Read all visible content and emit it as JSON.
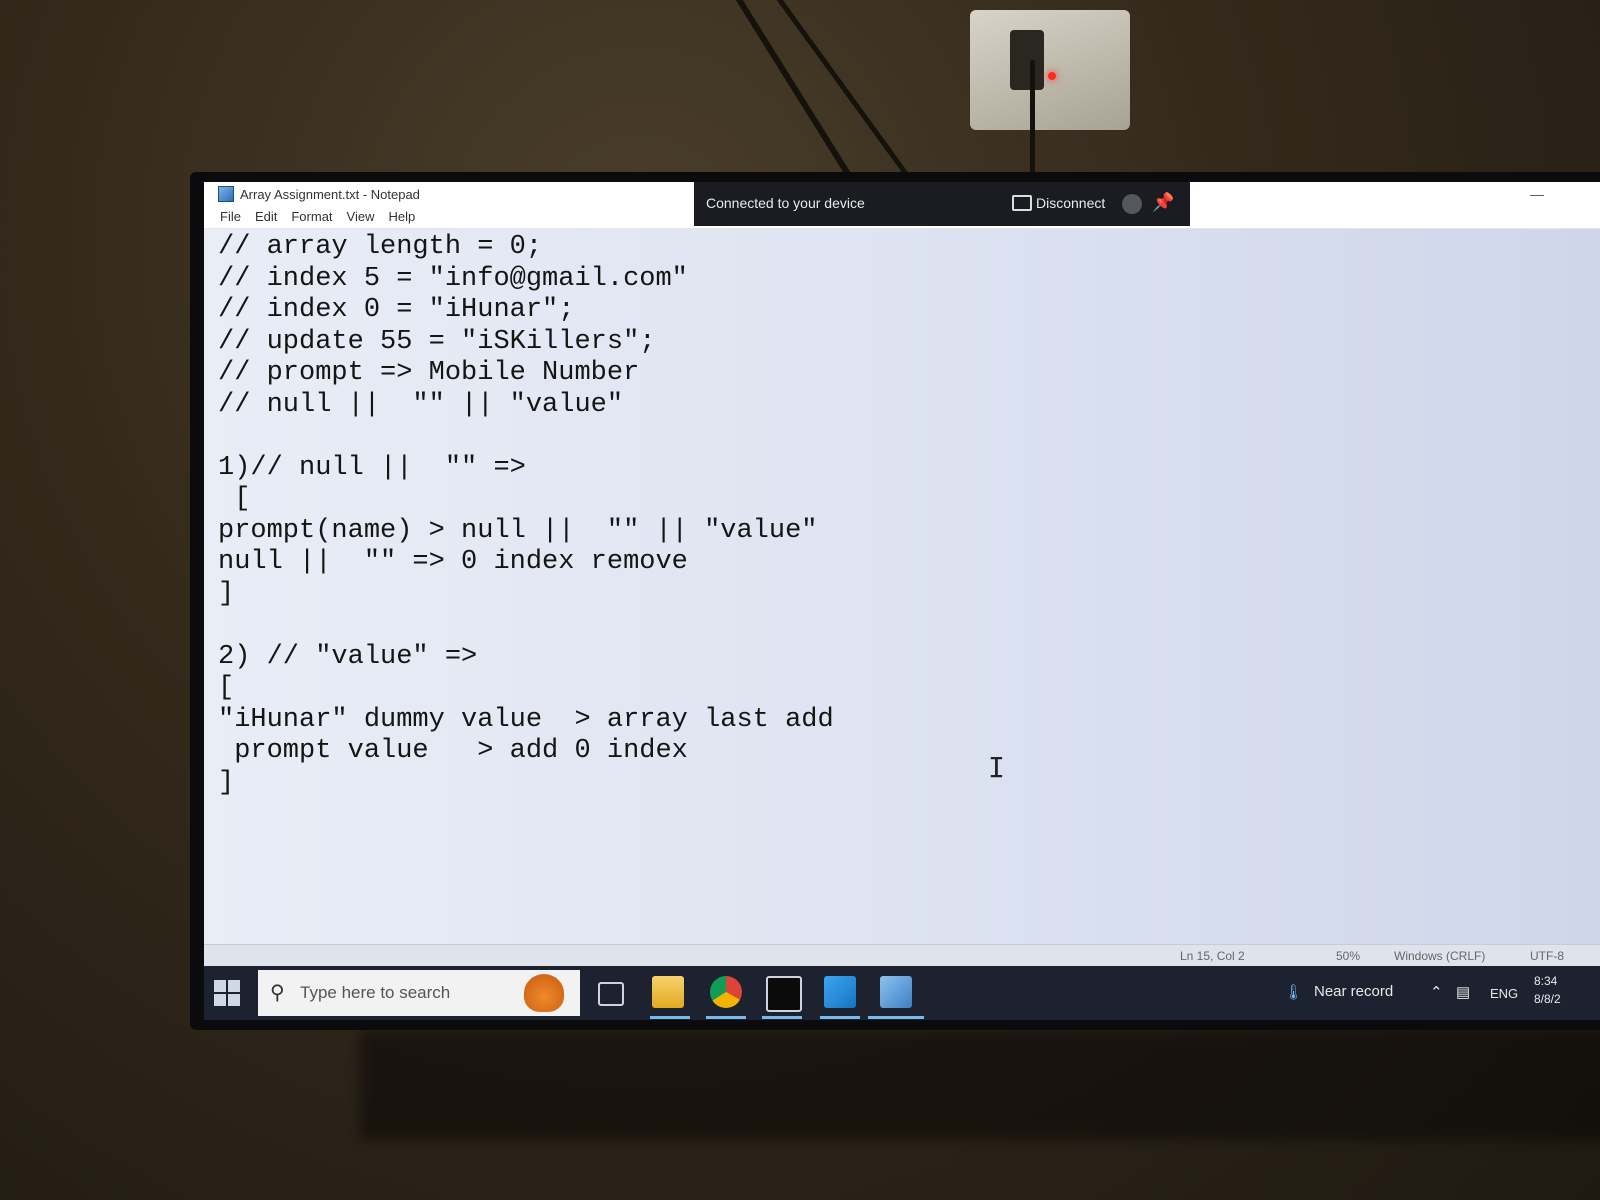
{
  "window": {
    "title": "Array Assignment.txt - Notepad",
    "menu": [
      "File",
      "Edit",
      "Format",
      "View",
      "Help"
    ]
  },
  "remote_bar": {
    "status": "Connected to your device",
    "disconnect_label": "Disconnect"
  },
  "editor": {
    "lines": [
      "// array length = 0;",
      "// index 5 = \"info@gmail.com\"",
      "// index 0 = \"iHunar\";",
      "// update 55 = \"iSKillers\";",
      "// prompt => Mobile Number",
      "// null ||  \"\" || \"value\"",
      "",
      "1)// null ||  \"\" =>",
      " [",
      "prompt(name) > null ||  \"\" || \"value\"",
      "null ||  \"\" => 0 index remove",
      "]",
      "",
      "2) // \"value\" =>",
      "[",
      "\"iHunar\" dummy value  > array last add",
      " prompt value   > add 0 index",
      "]"
    ]
  },
  "statusbar": {
    "position": "Ln 15, Col 2",
    "zoom": "50%",
    "line_ending": "Windows (CRLF)",
    "encoding": "UTF-8"
  },
  "taskbar": {
    "search_placeholder": "Type here to search",
    "weather": "Near record",
    "language": "ENG",
    "time": "8:34",
    "date": "8/8/2"
  },
  "icons": {
    "start": "windows-start-icon",
    "search": "magnifier-icon",
    "apps": [
      "task-view-icon",
      "file-explorer-icon",
      "chrome-icon",
      "terminal-icon",
      "vscode-icon",
      "notepad-icon"
    ]
  },
  "colors": {
    "taskbar": "#1d2230",
    "remote_bar": "#1a1c22",
    "accent_underline": "#76b9ed",
    "text": "#151515"
  }
}
